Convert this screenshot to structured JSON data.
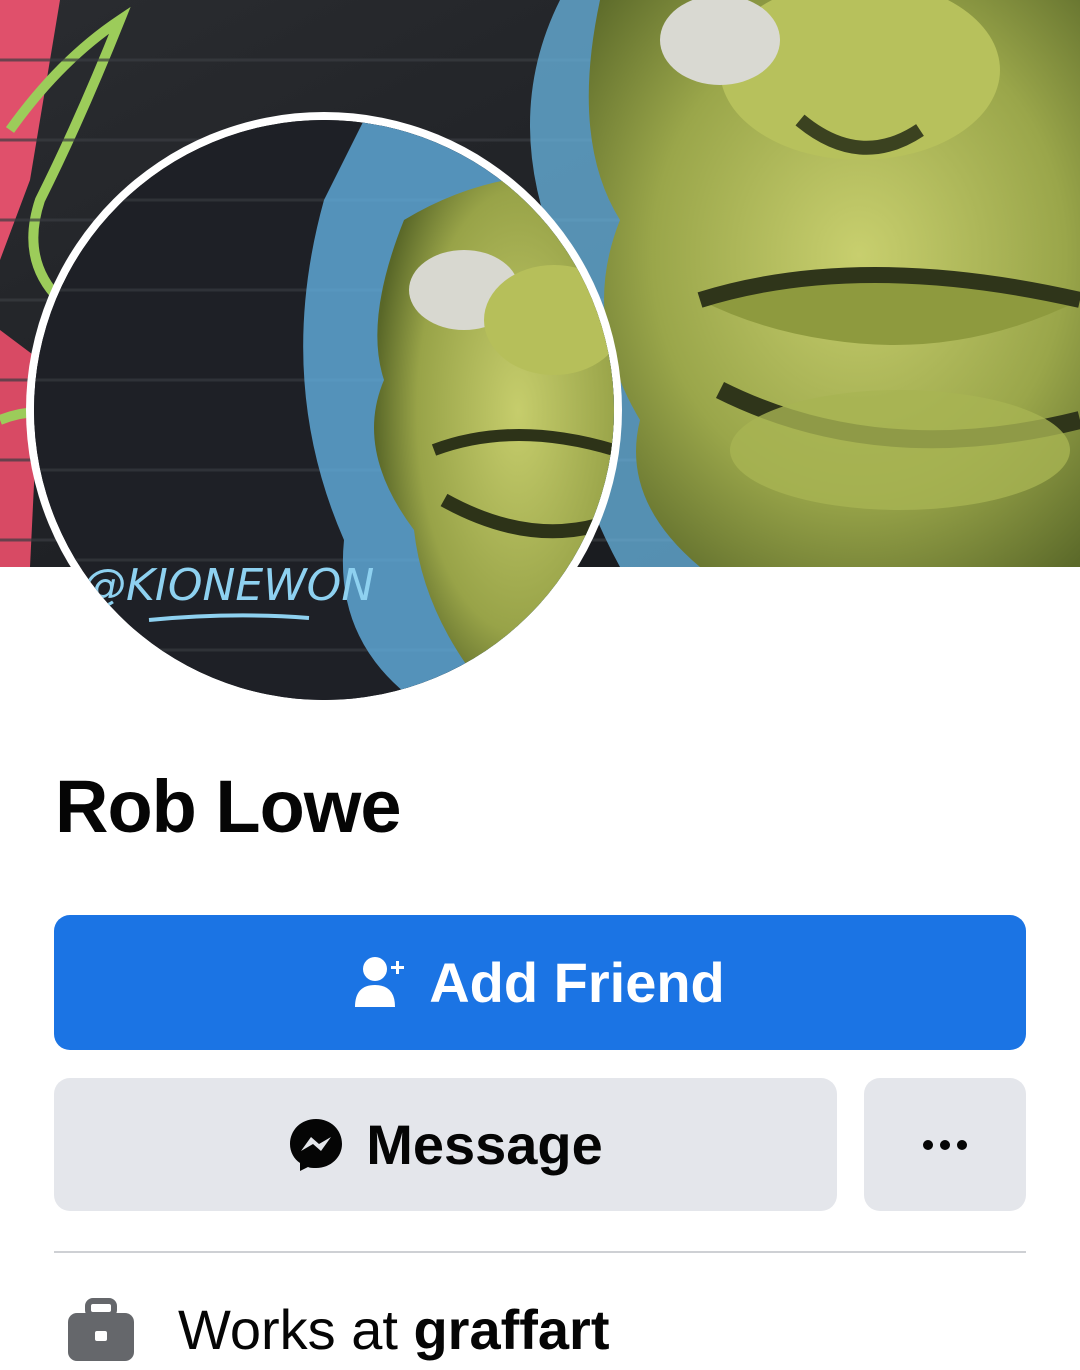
{
  "profile": {
    "name": "Rob Lowe",
    "cover_alt": "graffiti mural cover photo",
    "avatar_tag": "@KIONEWON"
  },
  "actions": {
    "add_friend_label": "Add Friend",
    "message_label": "Message",
    "more_label": "More"
  },
  "icons": {
    "add_friend": "add-person-icon",
    "message": "messenger-icon",
    "more": "ellipsis-icon",
    "work": "briefcase-icon"
  },
  "intro": {
    "work_prefix": "Works at ",
    "work_company": "graffart"
  },
  "colors": {
    "primary": "#1b74e4",
    "secondary_bg": "#e4e6eb",
    "text": "#050505",
    "divider": "#ced0d4"
  }
}
